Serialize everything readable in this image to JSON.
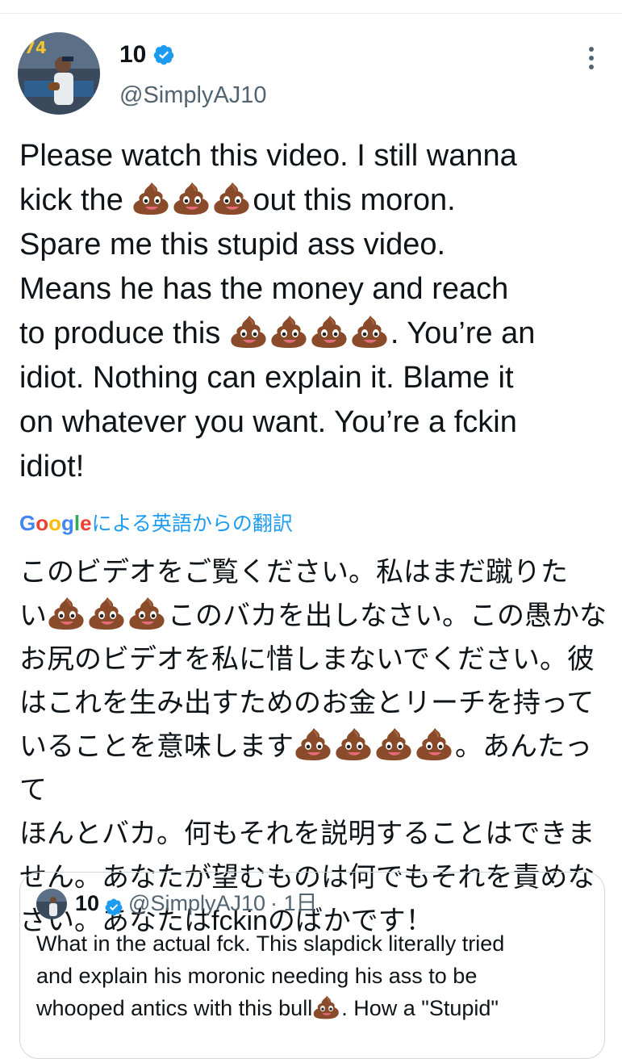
{
  "tweet": {
    "display_name": "10",
    "handle": "@SimplyAJ10",
    "text": {
      "p1": "Please watch this video. I still wanna\nkick the ",
      "e1": "💩💩💩",
      "p2": "out this moron.\nSpare me this stupid ass video.\nMeans he has the money and reach\nto produce this ",
      "e2": "💩💩💩💩",
      "p3": ". You’re an\nidiot. Nothing can explain it. Blame it\non whatever you want. You’re a fckin\nidiot!"
    },
    "translation_label": "による英語からの翻訳",
    "translation_provider": "Google",
    "translated": {
      "p1": "このビデオをご覧ください。私はまだ蹴りた\nい",
      "e1": "💩💩💩",
      "p2": "このバカを出しなさい。この愚かな\nお尻のビデオを私に惜しまないでください。彼\nはこれを生み出すためのお金とリーチを持って\nいることを意味します",
      "e2": "💩💩💩💩",
      "p3": "。あんたって\nほんとバカ。何もそれを説明することはできま\nせん。あなたが望むものは何でもそれを責めな\nさい。あなたはfckinのばかです！"
    }
  },
  "quoted_tweet": {
    "display_name": "10",
    "handle": "@SimplyAJ10",
    "time": "· 1日",
    "text": {
      "p1": "What in the actual fck. This slapdick literally tried\nand explain his moronic needing his ass to be\nwhooped antics with this bull",
      "e1": "💩",
      "p2": ". How a \"Stupid\""
    }
  },
  "colors": {
    "verified": "#1d9bf0",
    "link": "#1d9bf0",
    "secondary_text": "#536471",
    "border": "#cfd9de"
  },
  "icons": {
    "verified": "verified-badge-icon",
    "more": "more-vertical-icon",
    "emoji": "pile-of-poo-emoji"
  }
}
